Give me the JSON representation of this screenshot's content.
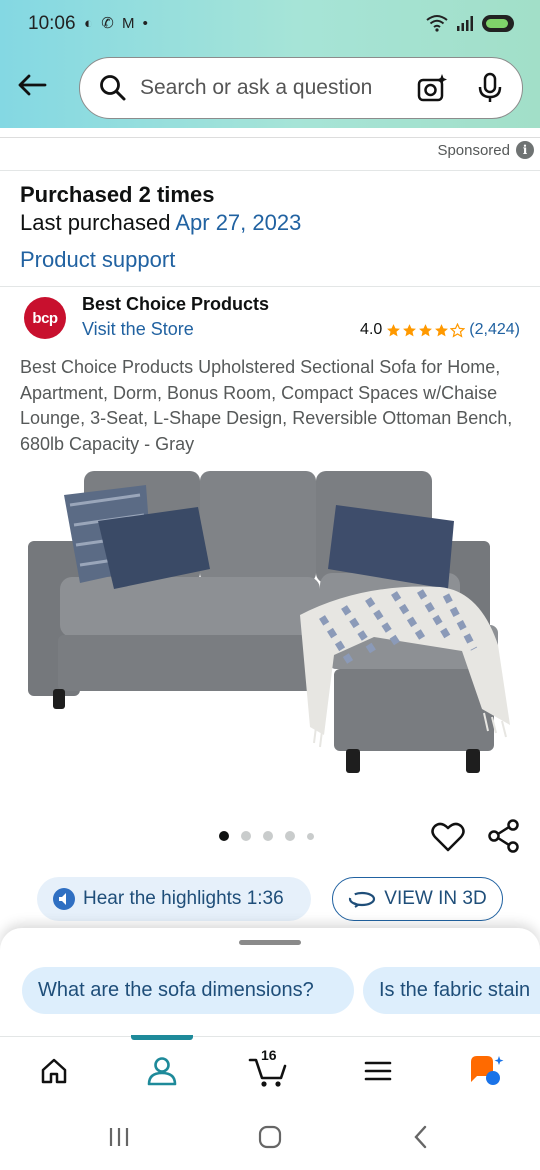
{
  "status_bar": {
    "time": "10:06",
    "left_icons": "◐ ✆ M •",
    "signal_label": "5"
  },
  "search": {
    "placeholder": "Search or ask a question"
  },
  "sponsored": {
    "label": "Sponsored"
  },
  "purchase_info": {
    "purchased": "Purchased 2 times",
    "last_purchased_prefix": "Last purchased ",
    "last_purchased_date": "Apr 27, 2023",
    "product_support": "Product support"
  },
  "brand": {
    "logo_text": "bcp",
    "name": "Best Choice Products",
    "visit_store": "Visit the Store"
  },
  "rating": {
    "value": "4.0",
    "stars": 4,
    "count": "(2,424)"
  },
  "product": {
    "title": "Best Choice Products Upholstered Sectional Sofa for Home, Apartment, Dorm, Bonus Room, Compact Spaces w/Chaise Lounge, 3-Seat, L-Shape Design, Reversible Ottoman Bench, 680lb Capacity - Gray",
    "image_alt": "Gray L-shaped sectional sofa with ottoman, blue pillows and a white patterned throw",
    "image_index": 1,
    "image_count": 5
  },
  "actions": {
    "hear_highlights": "Hear the highlights 1:36",
    "view_3d": "VIEW IN 3D"
  },
  "suggestions": [
    "What are the sofa dimensions?",
    "Is the fabric stain"
  ],
  "nav": {
    "cart_count": "16",
    "active_tab": "account"
  },
  "colors": {
    "link": "#2162a1",
    "star": "#ff9900",
    "accent": "#1e8a9a",
    "chip_bg": "#ddeefc"
  }
}
